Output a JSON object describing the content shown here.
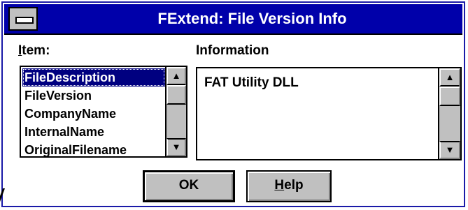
{
  "window": {
    "title": "FExtend: File Version Info"
  },
  "item_label": {
    "mnemonic": "I",
    "rest": "tem:"
  },
  "information_label": "Information",
  "item_list": [
    {
      "label": "FileDescription",
      "selected": true
    },
    {
      "label": "FileVersion",
      "selected": false
    },
    {
      "label": "CompanyName",
      "selected": false
    },
    {
      "label": "InternalName",
      "selected": false
    },
    {
      "label": "OriginalFilename",
      "selected": false
    }
  ],
  "information_value": "FAT Utility DLL",
  "buttons": {
    "ok": "OK",
    "help": {
      "mnemonic": "H",
      "rest": "elp"
    }
  },
  "icons": {
    "scroll_up": "▲",
    "scroll_down": "▼",
    "system_menu": "system-menu-icon"
  },
  "colors": {
    "titlebar": "#0000aa",
    "selection": "#000080",
    "face": "#c0c0c0"
  }
}
